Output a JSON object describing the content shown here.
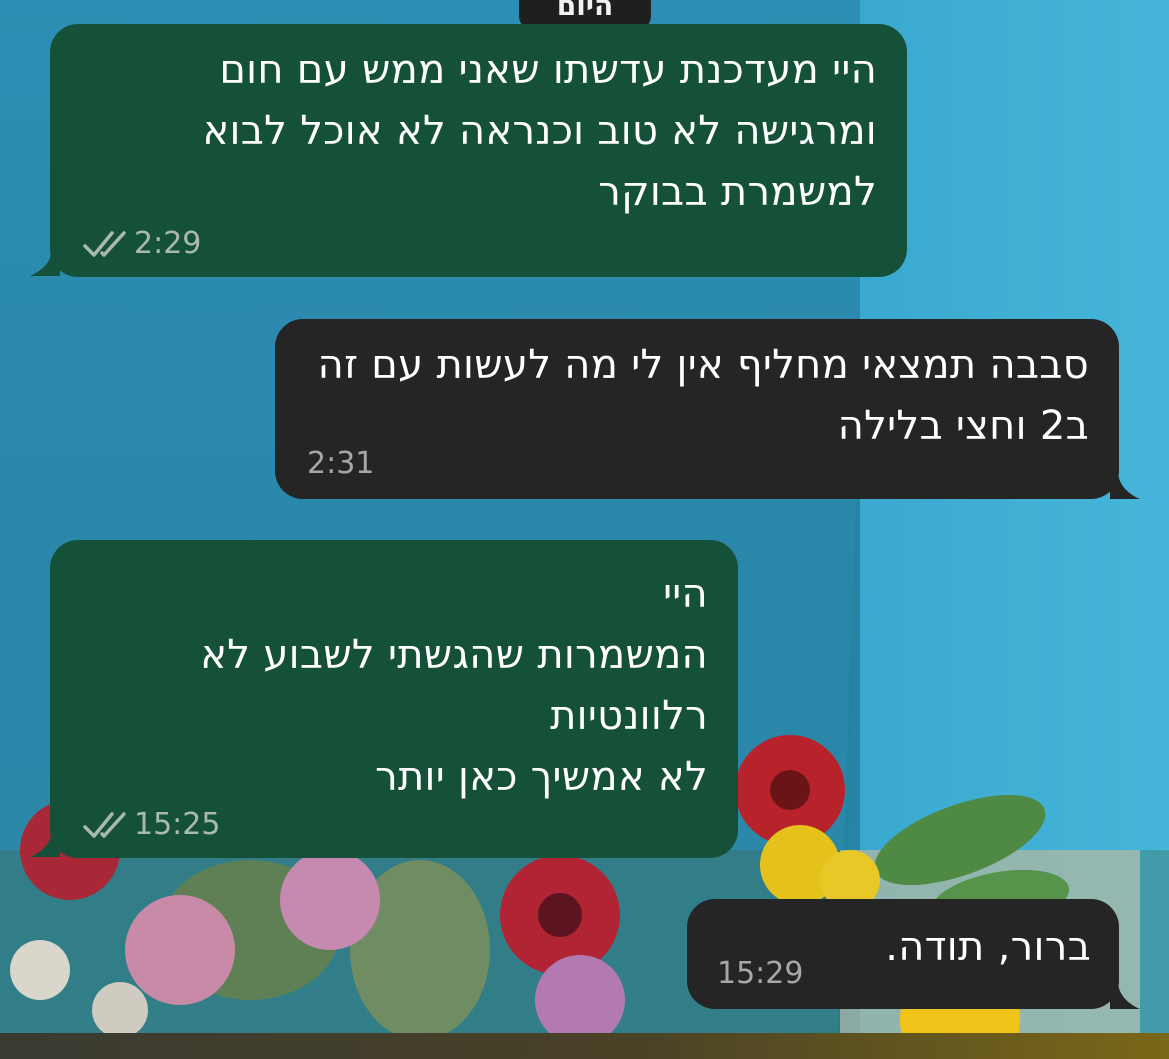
{
  "date_separator": "היום",
  "messages": [
    {
      "direction": "outgoing",
      "text": "היי מעדכנת עדשתו שאני ממש עם חום ומרגישה לא טוב וכנראה לא אוכל לבוא למשמרת בבוקר",
      "time": "2:29",
      "read_receipt_icon": "double-check-icon"
    },
    {
      "direction": "incoming",
      "text": "סבבה תמצאי מחליף אין לי מה לעשות עם זה ב2 וחצי בלילה",
      "time": "2:31"
    },
    {
      "direction": "outgoing",
      "text": "היי\nהמשמרות שהגשתי לשבוע לא רלוונטיות\nלא אמשיך כאן יותר",
      "time": "15:25",
      "read_receipt_icon": "double-check-icon"
    },
    {
      "direction": "incoming",
      "text": "ברור, תודה.",
      "time": "15:29"
    }
  ],
  "colors": {
    "outgoing_bubble": "#155139",
    "incoming_bubble": "#252526",
    "wallpaper": "#2f9bc0"
  }
}
